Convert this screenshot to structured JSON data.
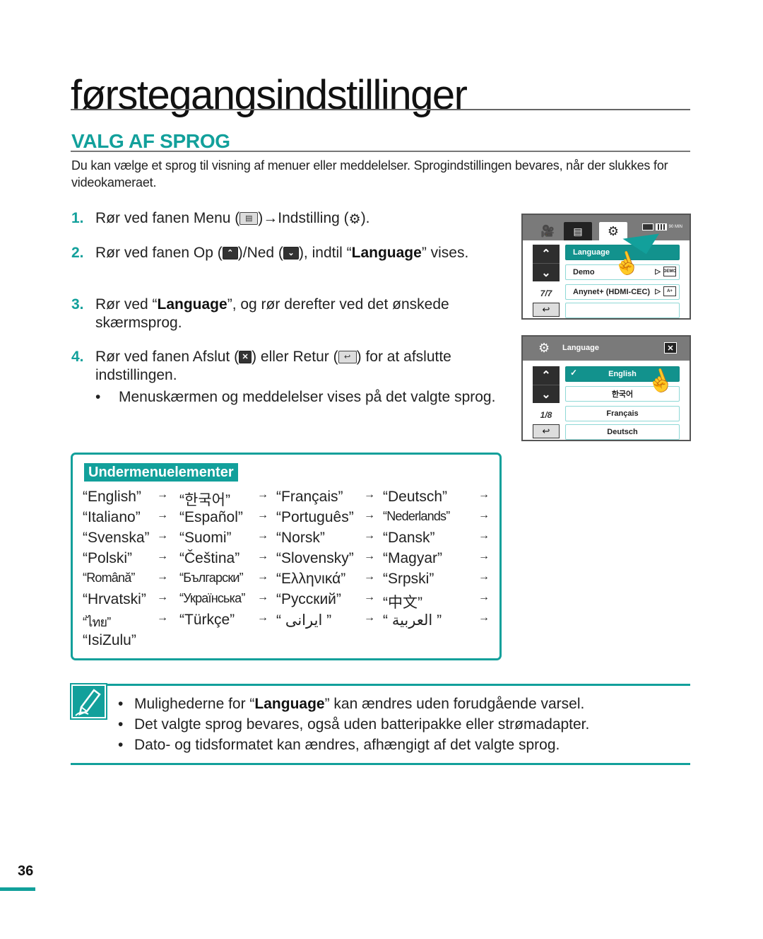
{
  "page": {
    "title": "førstegangsindstillinger",
    "section_title": "VALG AF SPROG",
    "intro": "Du kan vælge et sprog til visning af menuer eller meddelelser. Sprogindstillingen bevares, når der slukkes for videokameraet.",
    "page_number": "36"
  },
  "steps": [
    {
      "num": "1.",
      "pre": "Rør ved fanen Menu (",
      "mid": ")→Indstilling (",
      "post": ").",
      "icons": [
        "menu-icon",
        "gear-icon"
      ]
    },
    {
      "num": "2.",
      "pre": "Rør ved fanen Op (",
      "mid": ")/Ned (",
      "post1": "), indtil “",
      "bold": "Language",
      "post2": "” vises.",
      "icons": [
        "up-icon",
        "down-icon"
      ]
    },
    {
      "num": "3.",
      "pre": "Rør ved “",
      "bold": "Language",
      "post": "”, og rør derefter ved det ønskede skærmsprog."
    },
    {
      "num": "4.",
      "pre": "Rør ved fanen Afslut (",
      "mid": ") eller Retur (",
      "post": ") for at afslutte indstillingen.",
      "icons": [
        "close-icon",
        "return-icon"
      ],
      "sub_bullet": "Menuskærmen og meddelelser vises på det valgte sprog."
    }
  ],
  "screen1": {
    "items": [
      "Language",
      "Demo",
      "Anynet+ (HDMI-CEC)",
      ""
    ],
    "page_indicator": "7/7",
    "demo_badge": "DEMO",
    "status_mem": "90 MIN"
  },
  "screen2": {
    "title": "Language",
    "items": [
      "English",
      "한국어",
      "Français",
      "Deutsch"
    ],
    "page_indicator": "1/8",
    "selected": "English"
  },
  "submenu": {
    "label": "Undermenuelementer",
    "rows": [
      [
        "“English”",
        "“한국어”",
        "“Français”",
        "“Deutsch”"
      ],
      [
        "“Italiano”",
        "“Español”",
        "“Português”",
        "“Nederlands”"
      ],
      [
        "“Svenska”",
        "“Suomi”",
        "“Norsk”",
        "“Dansk”"
      ],
      [
        "“Polski”",
        "“Čeština”",
        "“Slovensky”",
        "“Magyar”"
      ],
      [
        "“Română”",
        "“Български”",
        "“Ελληνικά”",
        "“Srpski”"
      ],
      [
        "“Hrvatski”",
        "“Українська”",
        "“Русский”",
        "“中文”"
      ],
      [
        "“ไทย”",
        "“Türkçe”",
        "“ ایرانی ”",
        "“ العربية ”"
      ],
      [
        "“IsiZulu”"
      ]
    ],
    "arrow": "→"
  },
  "notes": [
    {
      "pre": "Mulighederne for “",
      "bold": "Language",
      "post": "” kan ændres uden forudgående varsel."
    },
    {
      "pre": "Det valgte sprog bevares, også uden batteripakke eller strømadapter."
    },
    {
      "pre": "Dato- og tidsformatet kan ændres, afhængigt af det valgte sprog."
    }
  ],
  "colors": {
    "accent": "#12a09b"
  }
}
